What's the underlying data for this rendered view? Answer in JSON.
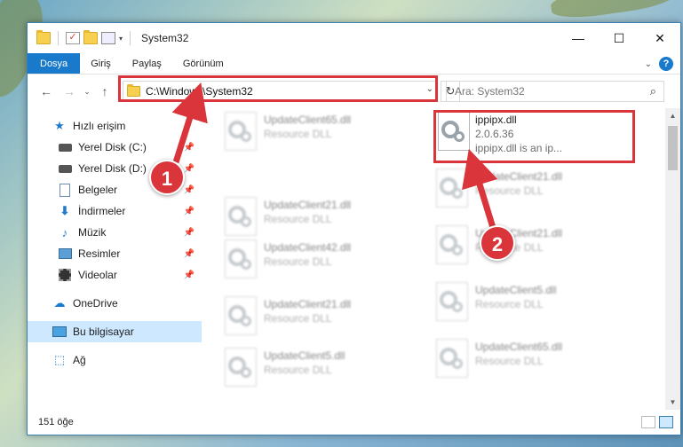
{
  "window": {
    "title": "System32",
    "controls": {
      "minimize": "—",
      "maximize": "☐",
      "close": "✕"
    }
  },
  "ribbon": {
    "tabs": [
      "Dosya",
      "Giriş",
      "Paylaş",
      "Görünüm"
    ]
  },
  "address": {
    "path": "C:\\Windows\\System32",
    "search_placeholder": "Ara: System32"
  },
  "sidebar": {
    "items": [
      {
        "label": "Hızlı erişim",
        "icon": "star-icon"
      },
      {
        "label": "Yerel Disk (C:)",
        "icon": "disk-icon",
        "pinned": true
      },
      {
        "label": "Yerel Disk (D:)",
        "icon": "disk-icon",
        "pinned": true
      },
      {
        "label": "Belgeler",
        "icon": "document-icon",
        "pinned": true
      },
      {
        "label": "İndirmeler",
        "icon": "download-icon",
        "pinned": true
      },
      {
        "label": "Müzik",
        "icon": "music-icon",
        "pinned": true
      },
      {
        "label": "Resimler",
        "icon": "pictures-icon",
        "pinned": true
      },
      {
        "label": "Videolar",
        "icon": "videos-icon",
        "pinned": true
      },
      {
        "label": "OneDrive",
        "icon": "cloud-icon"
      },
      {
        "label": "Bu bilgisayar",
        "icon": "computer-icon",
        "selected": true
      },
      {
        "label": "Ağ",
        "icon": "network-icon"
      }
    ]
  },
  "files": {
    "highlighted": {
      "name": "ippipx.dll",
      "version": "2.0.6.36",
      "desc": "ippipx.dll is an ip..."
    },
    "left_column": [
      {
        "name": "UpdateClient65.dll",
        "desc": "Resource DLL"
      },
      {
        "name": "UpdateClient21.dll",
        "desc": "Resource DLL"
      },
      {
        "name": "UpdateClient42.dll",
        "desc": "Resource DLL"
      },
      {
        "name": "UpdateClient21.dll",
        "desc": "Resource DLL"
      },
      {
        "name": "UpdateClient5.dll",
        "desc": "Resource DLL"
      }
    ],
    "right_column": [
      {
        "name": "UpdateClient21.dll",
        "desc": "Resource DLL"
      },
      {
        "name": "UpdateClient21.dll",
        "desc": "Resource DLL"
      },
      {
        "name": "UpdateClient5.dll",
        "desc": "Resource DLL"
      },
      {
        "name": "UpdateClient65.dll",
        "desc": "Resource DLL"
      }
    ]
  },
  "status": {
    "count": "151 öğe"
  },
  "callouts": {
    "one": "1",
    "two": "2"
  },
  "colors": {
    "accent": "#1979ca",
    "annotation": "#d9353b",
    "selection": "#cde8ff"
  }
}
